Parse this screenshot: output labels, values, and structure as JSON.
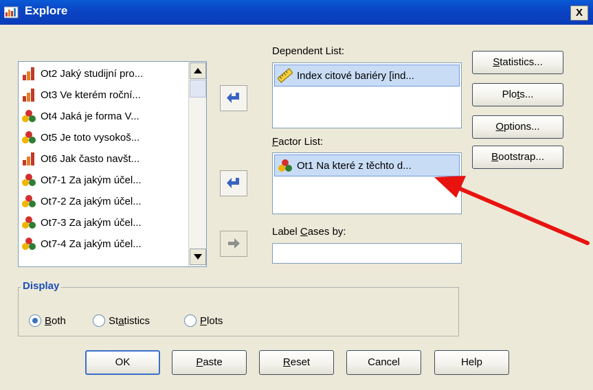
{
  "window": {
    "title": "Explore",
    "close_label": "X"
  },
  "source_list": {
    "items": [
      {
        "label": "Ot2 Jaký studijní pro...",
        "icon": "scale-bar-chart-icon"
      },
      {
        "label": "Ot3 Ve kterém roční...",
        "icon": "scale-bar-chart-icon"
      },
      {
        "label": "Ot4 Jaká je forma V...",
        "icon": "nominal-circles-icon"
      },
      {
        "label": "Ot5 Je toto vysokoš...",
        "icon": "nominal-circles-icon"
      },
      {
        "label": "Ot6 Jak často navšt...",
        "icon": "scale-bar-chart-icon"
      },
      {
        "label": "Ot7-1 Za jakým účel...",
        "icon": "nominal-circles-icon"
      },
      {
        "label": "Ot7-2 Za jakým účel...",
        "icon": "nominal-circles-icon"
      },
      {
        "label": "Ot7-3 Za jakým účel...",
        "icon": "nominal-circles-icon"
      },
      {
        "label": "Ot7-4 Za jakým účel...",
        "icon": "nominal-circles-icon"
      }
    ]
  },
  "dependent": {
    "label_pre": "Dependent List:",
    "item": "Index citové bariéry [ind...",
    "item_icon": "ruler-icon"
  },
  "factor": {
    "label_pre": "",
    "label_u": "F",
    "label_post": "actor List:",
    "item": "Ot1 Na které z těchto d...",
    "item_icon": "nominal-circles-icon"
  },
  "label_cases": {
    "label_pre": "Label ",
    "label_u": "C",
    "label_post": "ases by:"
  },
  "side_buttons": {
    "statistics": {
      "u": "S",
      "rest": "tatistics..."
    },
    "plots": {
      "pre": "Plo",
      "u": "t",
      "rest": "s..."
    },
    "options": {
      "u": "O",
      "rest": "ptions..."
    },
    "bootstrap": {
      "u": "B",
      "rest": "ootstrap..."
    }
  },
  "display": {
    "legend": "Display",
    "both": {
      "u": "B",
      "rest": "oth"
    },
    "statistics": {
      "pre": "St",
      "u": "a",
      "rest": "tistics"
    },
    "plots": {
      "u": "P",
      "rest": "lots"
    },
    "selected": "Both"
  },
  "bottom_buttons": {
    "ok": "OK",
    "paste": {
      "u": "P",
      "rest": "aste"
    },
    "reset": {
      "u": "R",
      "rest": "eset"
    },
    "cancel": "Cancel",
    "help": "Help"
  },
  "colors": {
    "title_bar": "#0a44c4",
    "annotation_arrow": "#e8130f",
    "legend_text": "#1c4fb8"
  }
}
